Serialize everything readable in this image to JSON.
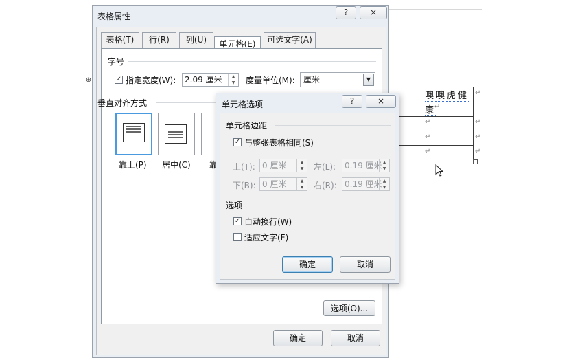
{
  "document": {
    "cell_text_line1": "噢噢虎健",
    "cell_text_line2": "康",
    "para_mark": "↵",
    "move_handle": "⊕"
  },
  "table_props_dialog": {
    "title": "表格属性",
    "help_button": "?",
    "close_button": "×",
    "tabs": [
      {
        "label": "表格(T)",
        "active": false
      },
      {
        "label": "行(R)",
        "active": false
      },
      {
        "label": "列(U)",
        "active": false
      },
      {
        "label": "单元格(E)",
        "active": true
      },
      {
        "label": "可选文字(A)",
        "active": false
      }
    ],
    "size_group_label": "字号",
    "specify_width_label": "指定宽度(W):",
    "specify_width_checked": true,
    "width_value": "2.09 厘米",
    "measure_unit_label": "度量单位(M):",
    "measure_unit_value": "厘米",
    "valign_group_label": "垂直对齐方式",
    "valign_options": [
      {
        "label": "靠上(P)",
        "selected": true
      },
      {
        "label": "居中(C)",
        "selected": false
      },
      {
        "label": "靠",
        "selected": false
      }
    ],
    "options_button": "选项(O)...",
    "ok_button": "确定",
    "cancel_button": "取消"
  },
  "cell_options_dialog": {
    "title": "单元格选项",
    "help_button": "?",
    "close_button": "×",
    "margins_group_label": "单元格边距",
    "same_as_table_label": "与整张表格相同(S)",
    "same_as_table_checked": true,
    "top_label": "上(T):",
    "top_value": "0 厘米",
    "left_label": "左(L):",
    "left_value": "0.19 厘米",
    "bottom_label": "下(B):",
    "bottom_value": "0 厘米",
    "right_label": "右(R):",
    "right_value": "0.19 厘米",
    "options_group_label": "选项",
    "wrap_text_label": "自动换行(W)",
    "wrap_text_checked": true,
    "fit_text_label": "适应文字(F)",
    "fit_text_checked": false,
    "ok_button": "确定",
    "cancel_button": "取消"
  },
  "colors": {
    "accent_border": "#4a9ae0",
    "dialog_bg": "#f0f0f0"
  }
}
